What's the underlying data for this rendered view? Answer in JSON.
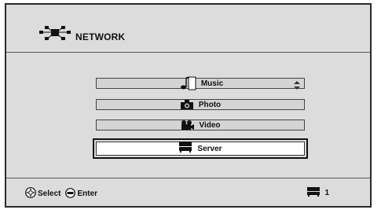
{
  "header": {
    "title": "NETWORK",
    "icon": "network-icon"
  },
  "menu": {
    "items": [
      {
        "label": "Music",
        "icon": "music-note-icon",
        "has_scroll_arrows": true
      },
      {
        "label": "Photo",
        "icon": "camera-icon"
      },
      {
        "label": "Video",
        "icon": "video-camera-icon"
      },
      {
        "label": "Server",
        "icon": "server-icon",
        "selected": true
      }
    ]
  },
  "footer": {
    "select_label": "Select",
    "select_icon": "directional-pad-icon",
    "enter_label": "Enter",
    "enter_icon": "enter-button-icon",
    "page_icon": "server-icon",
    "page_number": "1"
  }
}
